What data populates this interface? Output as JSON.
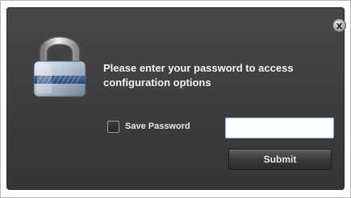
{
  "dialog": {
    "message": "Please enter your password to access configuration options",
    "close_icon": "close-icon",
    "close_glyph": "x",
    "lock_icon": "padlock-icon"
  },
  "form": {
    "save_password_label": "Save Password",
    "save_password_checked": false,
    "password_value": "",
    "submit_label": "Submit"
  },
  "colors": {
    "dialog_background": "#3f3f3f",
    "text": "#f2f2f2",
    "input_border": "#8fb4d9"
  }
}
